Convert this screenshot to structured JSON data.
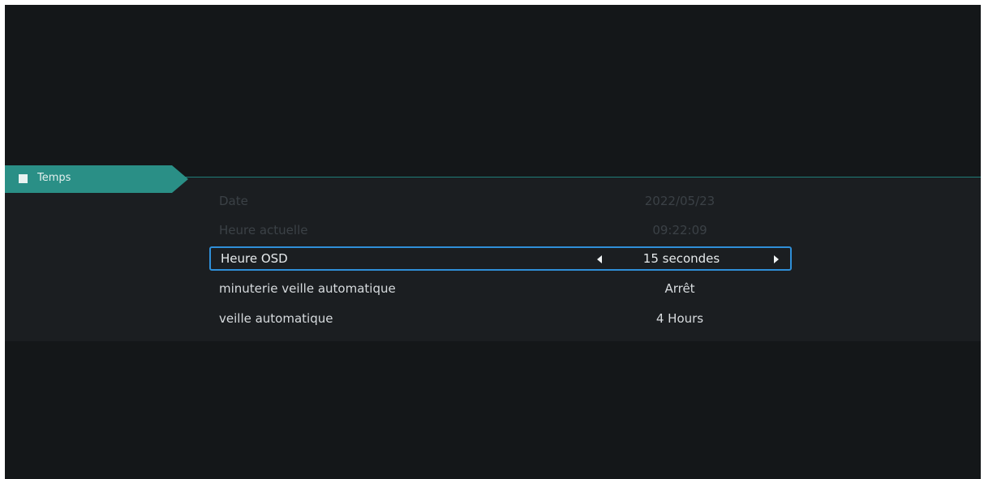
{
  "category": {
    "label": "Temps",
    "icon": "square-menu-icon"
  },
  "settings": [
    {
      "label": "Date",
      "value": "2022/05/23",
      "state": "disabled"
    },
    {
      "label": "Heure actuelle",
      "value": "09:22:09",
      "state": "disabled"
    },
    {
      "label": "Heure OSD",
      "value": "15 secondes",
      "state": "selected"
    },
    {
      "label": "minuterie veille automatique",
      "value": "Arrêt",
      "state": "normal"
    },
    {
      "label": "veille automatique",
      "value": "4 Hours",
      "state": "normal"
    }
  ],
  "colors": {
    "accent": "#2a8f86",
    "selection_border": "#2f8fd8",
    "background": "#141719"
  }
}
